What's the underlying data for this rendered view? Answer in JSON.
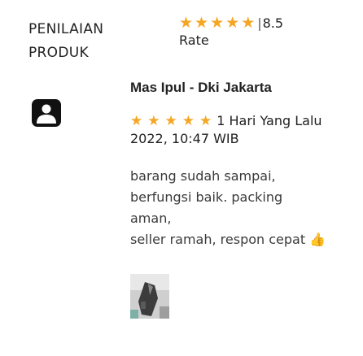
{
  "section": {
    "title": "PENILAIAN PRODUK"
  },
  "rating_summary": {
    "stars_filled": 5,
    "star_color": "#f5a623",
    "separator": "|",
    "score": "8.5",
    "label": "Rate"
  },
  "review": {
    "reviewer": "Mas Ipul - Dki Jakarta",
    "avatar_icon": "user-avatar-icon",
    "stars_filled": 5,
    "date": "1 Hari Yang Lalu 2022, 10:47 WIB",
    "body_lines": [
      "barang sudah sampai,",
      "berfungsi baik. packing",
      "aman,",
      "seller ramah, respon cepat"
    ],
    "thumbs_emoji": "👍",
    "photo_icon": "review-photo-thumbnail"
  }
}
